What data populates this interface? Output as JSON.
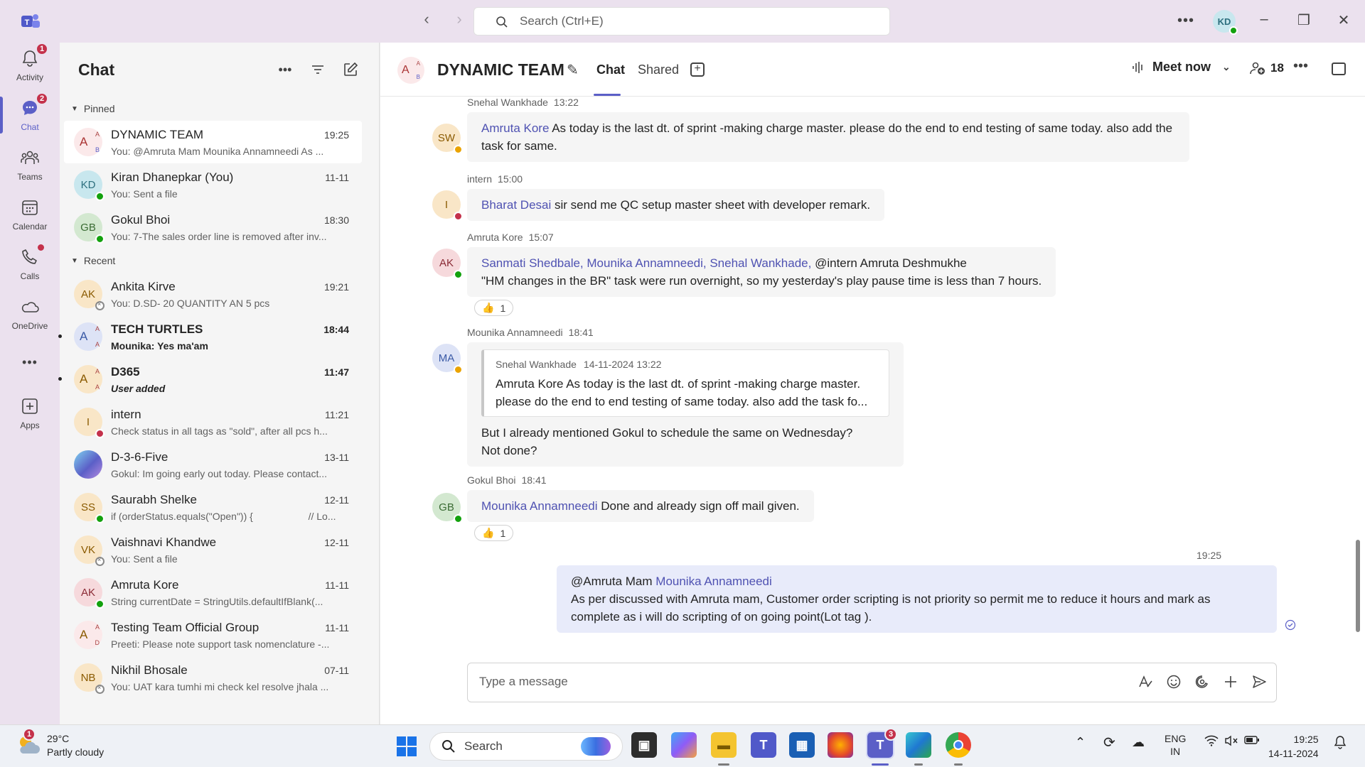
{
  "titlebar": {
    "search_placeholder": "Search (Ctrl+E)",
    "user_initials": "KD"
  },
  "rail": [
    {
      "label": "Activity",
      "badge": "1"
    },
    {
      "label": "Chat",
      "badge": "2"
    },
    {
      "label": "Teams",
      "badge": ""
    },
    {
      "label": "Calendar",
      "badge": ""
    },
    {
      "label": "Calls",
      "badge": ""
    },
    {
      "label": "OneDrive",
      "badge": ""
    },
    {
      "label": "Apps",
      "badge": ""
    }
  ],
  "chatlist": {
    "title": "Chat",
    "pinned_label": "Pinned",
    "recent_label": "Recent",
    "pinned": [
      {
        "name": "DYNAMIC TEAM",
        "time": "19:25",
        "preview": "You: @Amruta Mam Mounika Annamneedi As ..."
      },
      {
        "name": "Kiran Dhanepkar (You)",
        "time": "11-11",
        "preview": "You: Sent a file",
        "initials": "KD"
      },
      {
        "name": "Gokul Bhoi",
        "time": "18:30",
        "preview": "You: 7-The sales order line is removed after inv...",
        "initials": "GB"
      }
    ],
    "recent": [
      {
        "name": "Ankita Kirve",
        "time": "19:21",
        "preview": "You: D.SD- 20  QUANTITY AN 5 pcs",
        "initials": "AK"
      },
      {
        "name": "TECH TURTLES",
        "time": "18:44",
        "preview": "Mounika: Yes ma'am"
      },
      {
        "name": "D365",
        "time": "11:47",
        "preview": "User added"
      },
      {
        "name": "intern",
        "time": "11:21",
        "preview": "Check status in all tags as \"sold\", after all pcs h...",
        "initials": "I"
      },
      {
        "name": "D-3-6-Five",
        "time": "13-11",
        "preview": "Gokul: Im going early out today. Please contact..."
      },
      {
        "name": "Saurabh Shelke",
        "time": "12-11",
        "preview": "if (orderStatus.equals(\"Open\")) {                    // Lo...",
        "initials": "SS"
      },
      {
        "name": "Vaishnavi Khandwe",
        "time": "12-11",
        "preview": "You: Sent a file",
        "initials": "VK"
      },
      {
        "name": "Amruta Kore",
        "time": "11-11",
        "preview": "String currentDate = StringUtils.defaultIfBlank(...",
        "initials": "AK"
      },
      {
        "name": "Testing Team Official Group",
        "time": "11-11",
        "preview": "Preeti: Please note support task nomenclature -..."
      },
      {
        "name": "Nikhil Bhosale",
        "time": "07-11",
        "preview": "You: UAT kara tumhi mi check kel resolve jhala ...",
        "initials": "NB"
      }
    ]
  },
  "header": {
    "title": "DYNAMIC TEAM",
    "tab_chat": "Chat",
    "tab_shared": "Shared",
    "meet_now": "Meet now",
    "participants": "18"
  },
  "messages": {
    "m1": {
      "sender": "Snehal Wankhade",
      "time": "13:22",
      "initials": "SW",
      "mention": "Amruta Kore",
      "text": " As today is the last dt. of sprint -making charge master.  please do the end to end testing of same today.  also add the task for same."
    },
    "m2": {
      "sender": "intern",
      "time": "15:00",
      "initials": "I",
      "mention": "Bharat Desai",
      "text": " sir send me QC setup master sheet with developer remark."
    },
    "m3": {
      "sender": "Amruta Kore",
      "time": "15:07",
      "initials": "AK",
      "mentions": "Sanmati Shedbale, Mounika Annamneedi, Snehal Wankhade,",
      "text1": " @intern Amruta Deshmukhe",
      "text2": " \"HM changes in the BR\" task were run overnight, so my yesterday's play pause time is less than 7 hours.",
      "reaction": "1"
    },
    "m4": {
      "sender": "Mounika Annamneedi",
      "time": "18:41",
      "initials": "MA",
      "quote_author": "Snehal Wankhade",
      "quote_date": "14-11-2024 13:22",
      "quote_text": "Amruta Kore As today is the last dt. of sprint -making charge master. please do the end to end testing of same today. also add the task fo...",
      "text1": "But I already mentioned Gokul to schedule the same on Wednesday?",
      "text2": "Not done?"
    },
    "m5": {
      "sender": "Gokul Bhoi",
      "time": "18:41",
      "initials": "GB",
      "mention": "Mounika Annamneedi",
      "text": " Done and already sign off mail given.",
      "reaction": "1"
    },
    "m6": {
      "time": "19:25",
      "prefix": "@Amruta Mam ",
      "mention": "Mounika Annamneedi",
      "text": "As per discussed with Amruta mam, Customer order scripting is not priority so permit me to reduce it hours and mark as complete as i will do scripting of on going point(Lot tag )."
    }
  },
  "compose": {
    "placeholder": "Type a message"
  },
  "taskbar": {
    "weather_temp": "29°C",
    "weather_desc": "Partly cloudy",
    "weather_badge": "1",
    "search_label": "Search",
    "teams_badge": "3",
    "lang1": "ENG",
    "lang2": "IN",
    "time": "19:25",
    "date": "14-11-2024"
  },
  "colors": {
    "accent": "#5b5fc7",
    "mention": "#4f52b2",
    "badge": "#c4314b",
    "available": "#13a10e"
  }
}
